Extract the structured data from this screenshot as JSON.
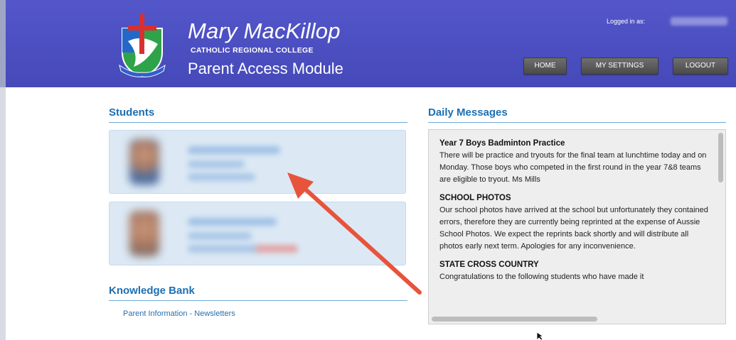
{
  "header": {
    "title": "Mary MacKillop",
    "subtitle": "CATHOLIC REGIONAL COLLEGE",
    "module": "Parent Access Module",
    "logged_in_label": "Logged in as:",
    "nav": [
      "HOME",
      "MY SETTINGS",
      "LOGOUT"
    ]
  },
  "students": {
    "title": "Students"
  },
  "knowledge_bank": {
    "title": "Knowledge Bank",
    "links": [
      "Parent Information - Newsletters"
    ]
  },
  "daily_messages": {
    "title": "Daily Messages",
    "messages": [
      {
        "title": "Year 7 Boys Badminton Practice",
        "body": "There will be practice and tryouts for the final team at lunchtime today and on Monday. Those boys who competed in the first round in the year 7&8 teams are eligible to tryout. Ms Mills"
      },
      {
        "title": "SCHOOL PHOTOS",
        "body": "Our school photos have arrived at the school but unfortunately they contained errors, therefore they are currently being reprinted at the expense of Aussie School Photos. We expect the reprints back shortly and will distribute all photos early next term. Apologies for any inconvenience."
      },
      {
        "title": "STATE CROSS COUNTRY",
        "body": "Congratulations to the following students who have made it"
      }
    ]
  },
  "colors": {
    "header": "#4d50c2",
    "section_title": "#1d6fb3",
    "card": "#dce9f5",
    "arrow": "#e8533c"
  }
}
